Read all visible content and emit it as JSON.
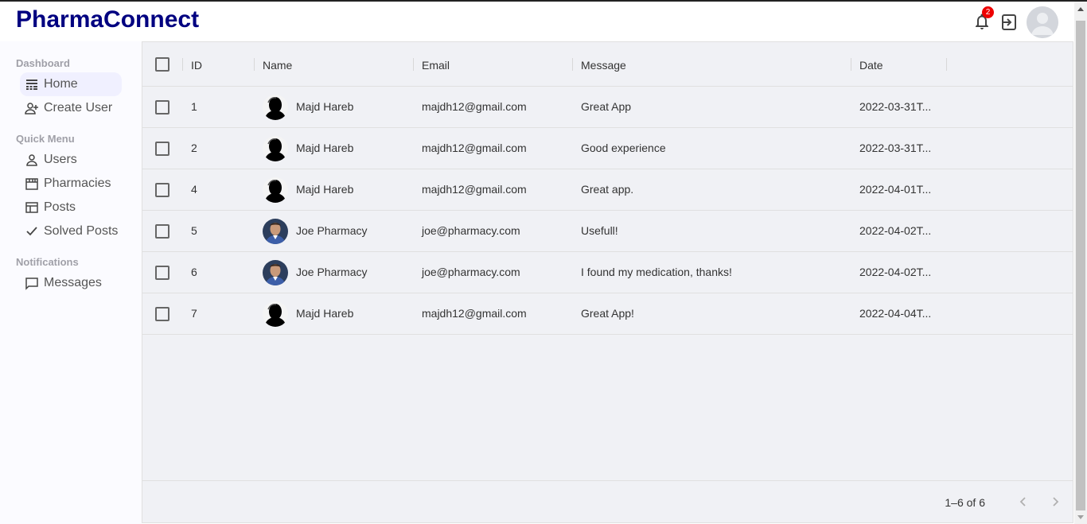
{
  "app": {
    "title": "PharmaConnect"
  },
  "topbar": {
    "notification_count": "2"
  },
  "sidebar": {
    "sections": [
      {
        "title": "Dashboard",
        "items": [
          {
            "label": "Home",
            "icon": "table-rows-icon",
            "active": true
          },
          {
            "label": "Create User",
            "icon": "person-add-icon"
          }
        ]
      },
      {
        "title": "Quick Menu",
        "items": [
          {
            "label": "Users",
            "icon": "person-outline-icon"
          },
          {
            "label": "Pharmacies",
            "icon": "storefront-icon"
          },
          {
            "label": "Posts",
            "icon": "web-icon"
          },
          {
            "label": "Solved Posts",
            "icon": "check-icon"
          }
        ]
      },
      {
        "title": "Notifications",
        "items": [
          {
            "label": "Messages",
            "icon": "chat-bubble-icon"
          }
        ]
      }
    ]
  },
  "grid": {
    "columns": [
      "ID",
      "Name",
      "Email",
      "Message",
      "Date"
    ],
    "rows": [
      {
        "id": "1",
        "name": "Majd Hareb",
        "avatar": "silhouette",
        "email": "majdh12@gmail.com",
        "message": "Great App",
        "date": "2022-03-31T..."
      },
      {
        "id": "2",
        "name": "Majd Hareb",
        "avatar": "silhouette",
        "email": "majdh12@gmail.com",
        "message": "Good experience",
        "date": "2022-03-31T..."
      },
      {
        "id": "4",
        "name": "Majd Hareb",
        "avatar": "silhouette",
        "email": "majdh12@gmail.com",
        "message": "Great app.",
        "date": "2022-04-01T..."
      },
      {
        "id": "5",
        "name": "Joe Pharmacy",
        "avatar": "photo",
        "email": "joe@pharmacy.com",
        "message": "Usefull!",
        "date": "2022-04-02T..."
      },
      {
        "id": "6",
        "name": "Joe Pharmacy",
        "avatar": "photo",
        "email": "joe@pharmacy.com",
        "message": "I found my medication, thanks!",
        "date": "2022-04-02T..."
      },
      {
        "id": "7",
        "name": "Majd Hareb",
        "avatar": "silhouette",
        "email": "majdh12@gmail.com",
        "message": "Great App!",
        "date": "2022-04-04T..."
      }
    ],
    "pagination": "1–6 of 6"
  },
  "colors": {
    "brand": "#000080",
    "badge": "#ee0000",
    "sidebar_bg": "#fbfbff",
    "grid_bg": "#f0f1f5",
    "active_bg": "#f0f0ff"
  }
}
